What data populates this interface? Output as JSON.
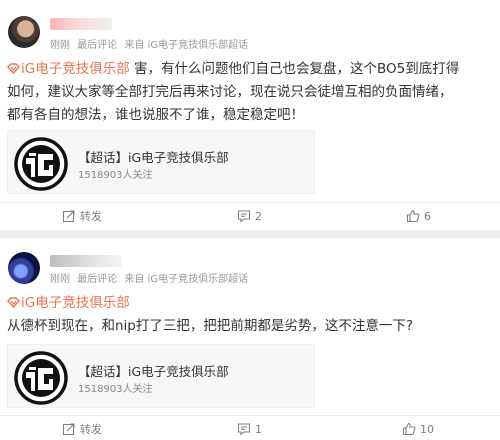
{
  "posts": [
    {
      "time": "刚刚",
      "comment_label": "最后评论",
      "source": "来自 iG电子竞技俱乐部超话",
      "topic": "iG电子竞技俱乐部",
      "text_line1_rest": "害，有什么问题他们自己也会复盘，这个BO5到底打得",
      "text_line2": "如何，建议大家等全部打完后再来讨论，现在说只会徒增互相的负面情绪，",
      "text_line3": "都有各自的想法，谁也说服不了谁，稳定稳定吧！",
      "card_title": "【超话】iG电子竞技俱乐部",
      "card_followers": "1518903人关注",
      "repost_label": "转发",
      "comments": "2",
      "likes": "6"
    },
    {
      "time": "刚刚",
      "comment_label": "最后评论",
      "source": "来自 iG电子竞技俱乐部超话",
      "topic": "iG电子竞技俱乐部",
      "text_line1": "从德杯到现在，和nip打了三把，把把前期都是劣势，这不注意一下?",
      "card_title": "【超话】iG电子竞技俱乐部",
      "card_followers": "1518903人关注",
      "repost_label": "转发",
      "comments": "1",
      "likes": "10"
    }
  ],
  "colors": {
    "topic": "#eb7350",
    "meta": "#999999",
    "background": "#eceef0"
  },
  "icons": [
    "avatar",
    "super-topic-icon",
    "ig-logo-icon",
    "repost-icon",
    "comment-icon",
    "like-icon"
  ]
}
